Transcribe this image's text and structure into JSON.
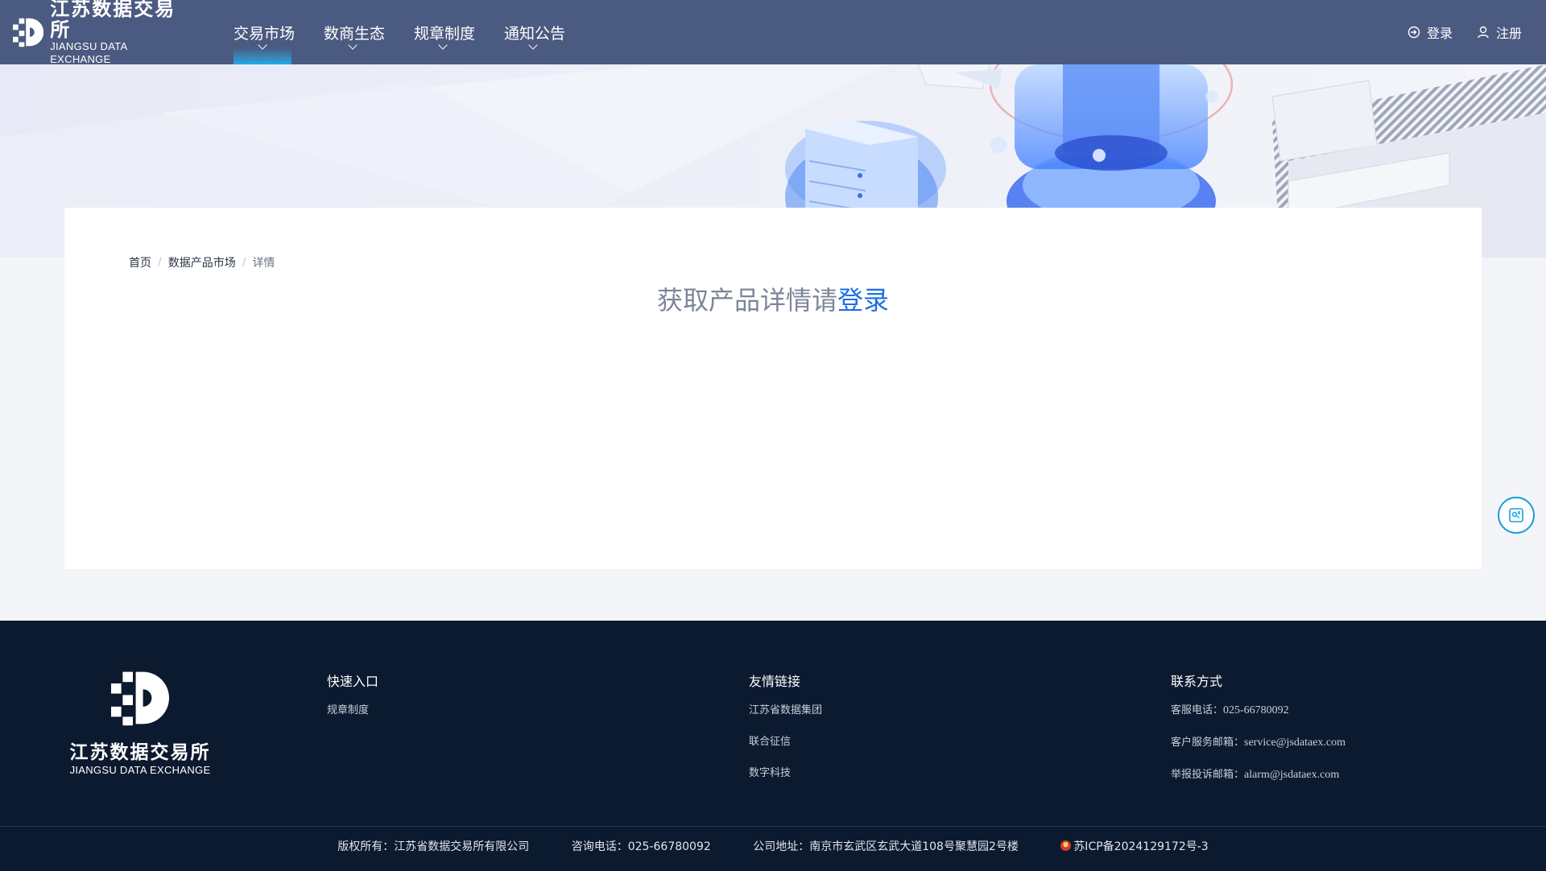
{
  "header": {
    "logo_cn": "江苏数据交易所",
    "logo_en": "JIANGSU DATA EXCHANGE",
    "nav": [
      {
        "label": "交易市场",
        "active": true
      },
      {
        "label": "数商生态",
        "active": false
      },
      {
        "label": "规章制度",
        "active": false
      },
      {
        "label": "通知公告",
        "active": false
      }
    ],
    "login_label": "登录",
    "register_label": "注册"
  },
  "breadcrumb": {
    "home": "首页",
    "market": "数据产品市场",
    "current": "详情"
  },
  "main": {
    "prompt_text": "获取产品详情请",
    "prompt_link": "登录"
  },
  "footer": {
    "logo_cn": "江苏数据交易所",
    "logo_en": "JIANGSU DATA EXCHANGE",
    "quick": {
      "title": "快速入口",
      "links": [
        "规章制度"
      ]
    },
    "friends": {
      "title": "友情链接",
      "links": [
        "江苏省数据集团",
        "联合征信",
        "数字科技"
      ]
    },
    "contact": {
      "title": "联系方式",
      "phone_label": "客服电话：",
      "phone": "025-66780092",
      "service_label": "客户服务邮箱：",
      "service_email": "service@jsdataex.com",
      "report_label": "举报投诉邮箱：",
      "report_email": "alarm@jsdataex.com"
    },
    "bottom": {
      "copyright": "版权所有：江苏省数据交易所有限公司",
      "consult": "咨询电话：025-66780092",
      "address": "公司地址：南京市玄武区玄武大道108号聚慧园2号楼",
      "icp": "苏ICP备2024129172号-3"
    }
  },
  "colors": {
    "header_bg": "#4b5a80",
    "accent": "#1c6fe3",
    "footer_bg": "#0c1a2f"
  }
}
